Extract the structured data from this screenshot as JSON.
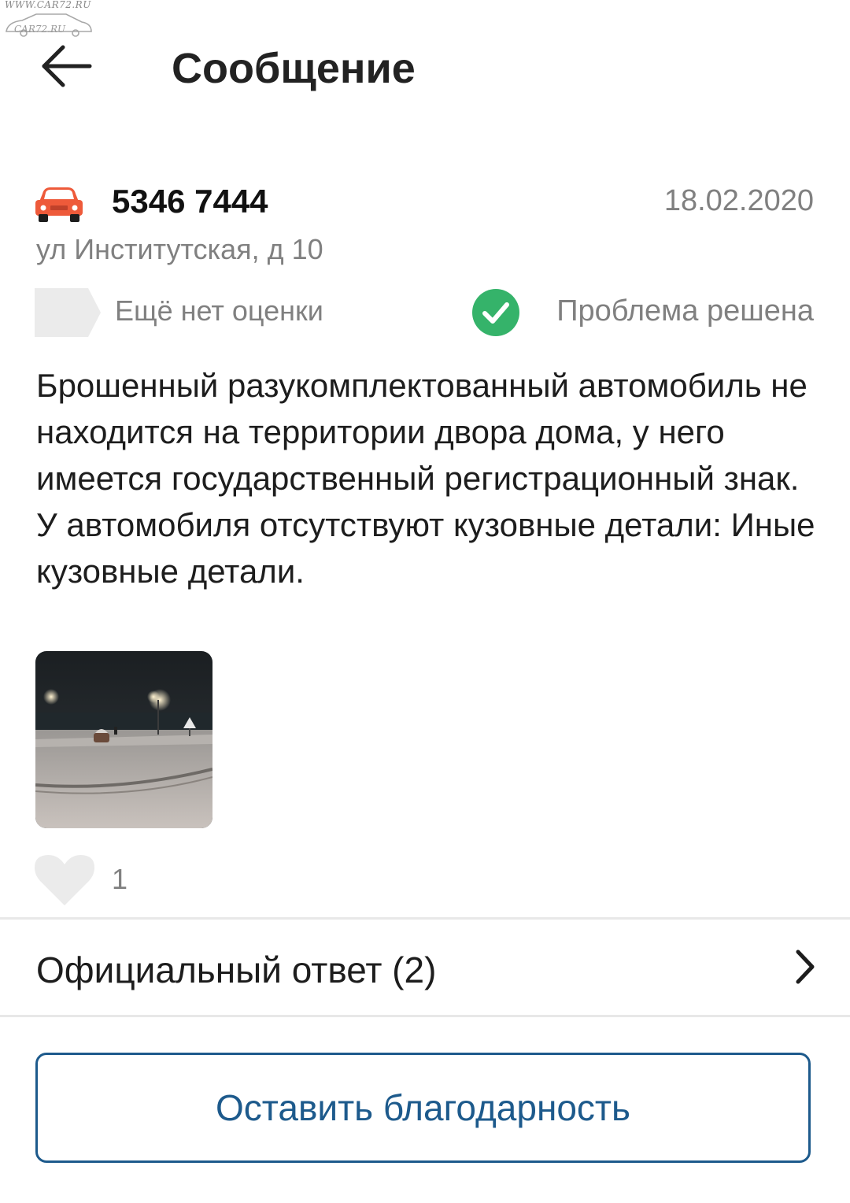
{
  "watermark": {
    "url": "WWW.CAR72.RU",
    "logo": "CAR72.RU"
  },
  "header": {
    "title": "Сообщение",
    "back_icon": "arrow-left-icon"
  },
  "report": {
    "plate": "5346 7444",
    "date": "18.02.2020",
    "address": "ул Институтская, д 10",
    "rating_text": "Ещё нет оценки",
    "status_text": "Проблема решена",
    "description": "Брошенный разукомплектованный автомобиль не находится на территории двора дома, у него имеется государственный регистрационный знак. У автомобиля отсутствуют кузовные детали: Иные кузовные детали.",
    "likes": "1",
    "car_icon": "car-icon",
    "status_icon": "check-circle-icon",
    "like_icon": "heart-icon"
  },
  "official_answer": {
    "label": "Официальный ответ (2)",
    "chevron_icon": "chevron-right-icon"
  },
  "actions": {
    "thanks_label": "Оставить благодарность"
  },
  "colors": {
    "accent": "#1d5a8c",
    "success": "#35b36a",
    "car": "#ee5a3a",
    "muted_text": "#808080",
    "placeholder": "#ebebeb"
  }
}
